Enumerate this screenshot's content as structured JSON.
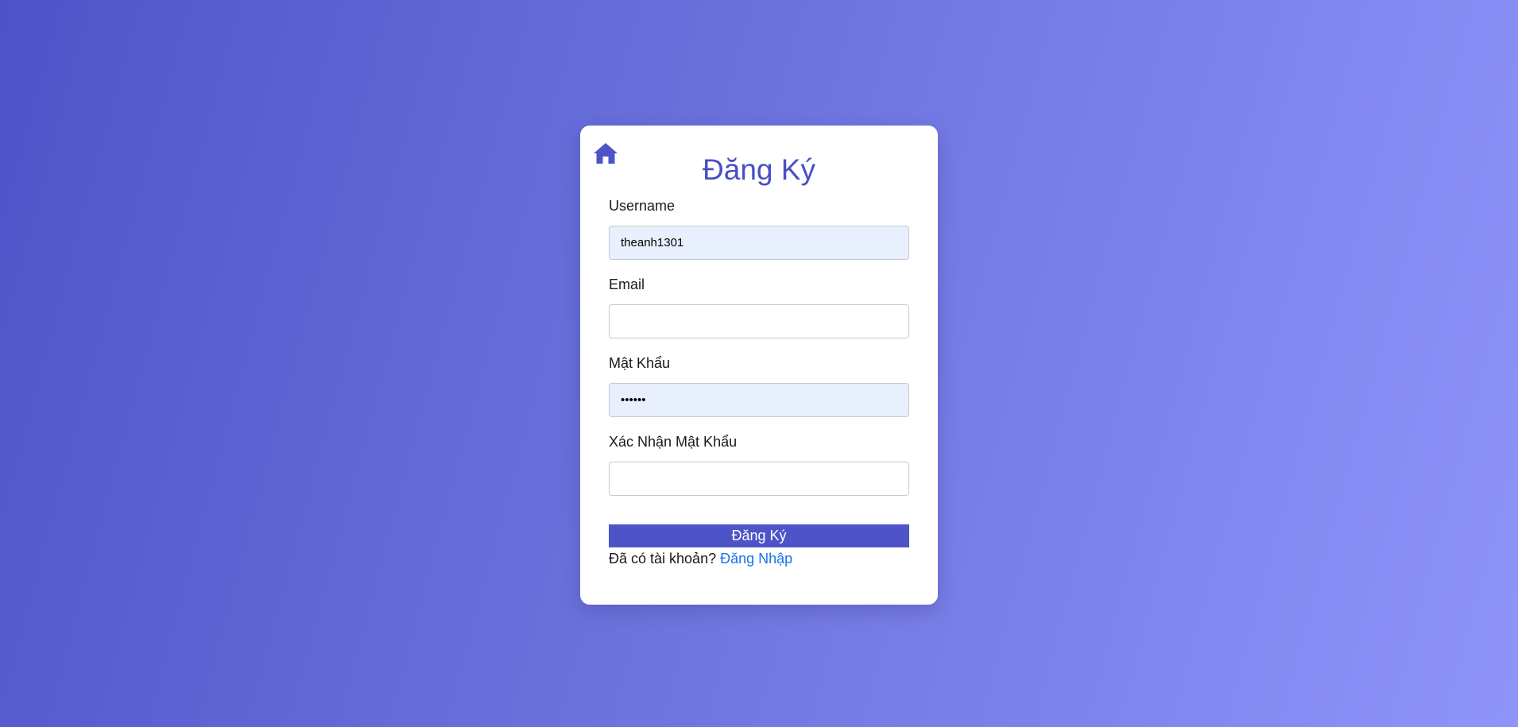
{
  "colors": {
    "accent": "#4e54c8",
    "gradient_start": "#4e54c8",
    "gradient_end": "#8f94fb",
    "link": "#1a73e8",
    "autofill_background": "#e8f0fe"
  },
  "header": {
    "home_icon": "home-icon",
    "title": "Đăng Ký"
  },
  "form": {
    "username": {
      "label": "Username",
      "value": "theanh1301",
      "placeholder": ""
    },
    "email": {
      "label": "Email",
      "value": "",
      "placeholder": ""
    },
    "password": {
      "label": "Mật Khẩu",
      "value": "••••••",
      "placeholder": ""
    },
    "confirm_password": {
      "label": "Xác Nhận Mật Khẩu",
      "value": "",
      "placeholder": ""
    },
    "submit_label": "Đăng Ký"
  },
  "footer": {
    "prompt": "Đã có tài khoản?",
    "login_link": "Đăng Nhập"
  }
}
